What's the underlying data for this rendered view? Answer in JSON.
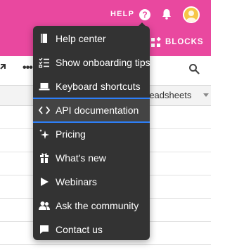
{
  "header": {
    "help_label": "HELP",
    "help_icon_glyph": "?",
    "bell_icon": "bell-icon",
    "avatar_icon": "avatar"
  },
  "toolbar": {
    "blocks_label": "BLOCKS",
    "blocks_icon": "blocks-icon"
  },
  "grid": {
    "column_header": "readsheets",
    "rows": [
      {
        "id": 1
      },
      {
        "id": 2
      },
      {
        "id": 3
      },
      {
        "id": 4
      },
      {
        "id": 5
      },
      {
        "id": 6
      }
    ]
  },
  "help_menu": {
    "items": [
      {
        "label": "Help center",
        "icon": "book-icon"
      },
      {
        "label": "Show onboarding tips",
        "icon": "checklist-icon"
      },
      {
        "label": "Keyboard shortcuts",
        "icon": "laptop-icon"
      },
      {
        "label": "API documentation",
        "icon": "code-icon",
        "highlighted": true
      },
      {
        "label": "Pricing",
        "icon": "sparkle-icon"
      },
      {
        "label": "What's new",
        "icon": "gift-icon"
      },
      {
        "label": "Webinars",
        "icon": "play-icon"
      },
      {
        "label": "Ask the community",
        "icon": "people-icon"
      },
      {
        "label": "Contact us",
        "icon": "chat-icon"
      }
    ]
  },
  "colors": {
    "brand_pink": "#e9489f",
    "menu_bg": "#333333",
    "highlight_border": "#2d7ff9",
    "avatar_yellow": "#f6c646"
  }
}
